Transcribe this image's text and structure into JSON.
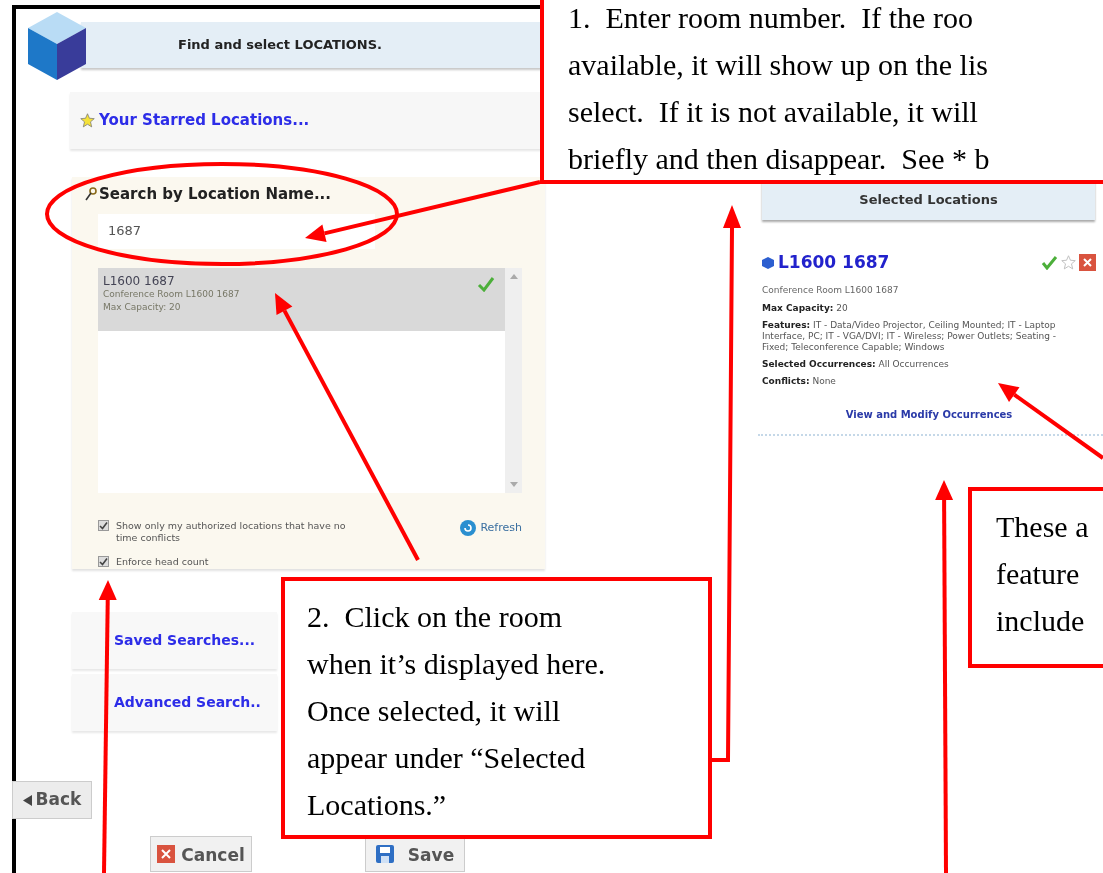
{
  "dialog": {
    "title": "Find and select LOCATIONS."
  },
  "starred": {
    "label": "Your Starred Locations..."
  },
  "search": {
    "title": "Search by Location Name...",
    "value": "1687",
    "results": [
      {
        "name": "L1600 1687",
        "description": "Conference Room L1600 1687",
        "capacity": "Max Capacity: 20",
        "selected": true
      }
    ],
    "options": [
      {
        "label": "Show only my authorized locations that have no time conflicts",
        "checked": true
      },
      {
        "label": "Enforce head count",
        "checked": true
      }
    ],
    "refresh": "Refresh"
  },
  "sections": [
    {
      "label": "Saved Searches..."
    },
    {
      "label": "Advanced Search.."
    }
  ],
  "buttons": {
    "back": "Back",
    "cancel": "Cancel",
    "save": "Save"
  },
  "selected_locations": {
    "title": "Selected Locations",
    "items": [
      {
        "name": "L1600 1687",
        "description": "Conference Room L1600 1687",
        "starred": false,
        "fields": [
          {
            "label": "Max Capacity:",
            "value": "20"
          },
          {
            "label": "Features:",
            "value": "IT - Data/Video Projector, Ceiling Mounted; IT - Laptop Interface, PC; IT - VGA/DVI; IT - Wireless; Power Outlets; Seating - Fixed; Teleconference Capable; Windows"
          },
          {
            "label": "Selected Occurrences:",
            "value": "All Occurrences"
          },
          {
            "label": "Conflicts:",
            "value": "None"
          }
        ],
        "link": "View and Modify Occurrences"
      }
    ]
  },
  "callouts": [
    {
      "lines": [
        "1.  Enter room number.  If the roo",
        "available, it will show up on the lis",
        "select.  If it is not available, it will",
        "briefly and then disappear.  See * b"
      ]
    },
    {
      "lines": [
        "2.  Click on the room",
        "when it’s displayed here.",
        "Once selected, it will",
        "appear under “Selected",
        "Locations.”"
      ]
    },
    {
      "lines": [
        "These a",
        "feature",
        "include"
      ]
    }
  ]
}
